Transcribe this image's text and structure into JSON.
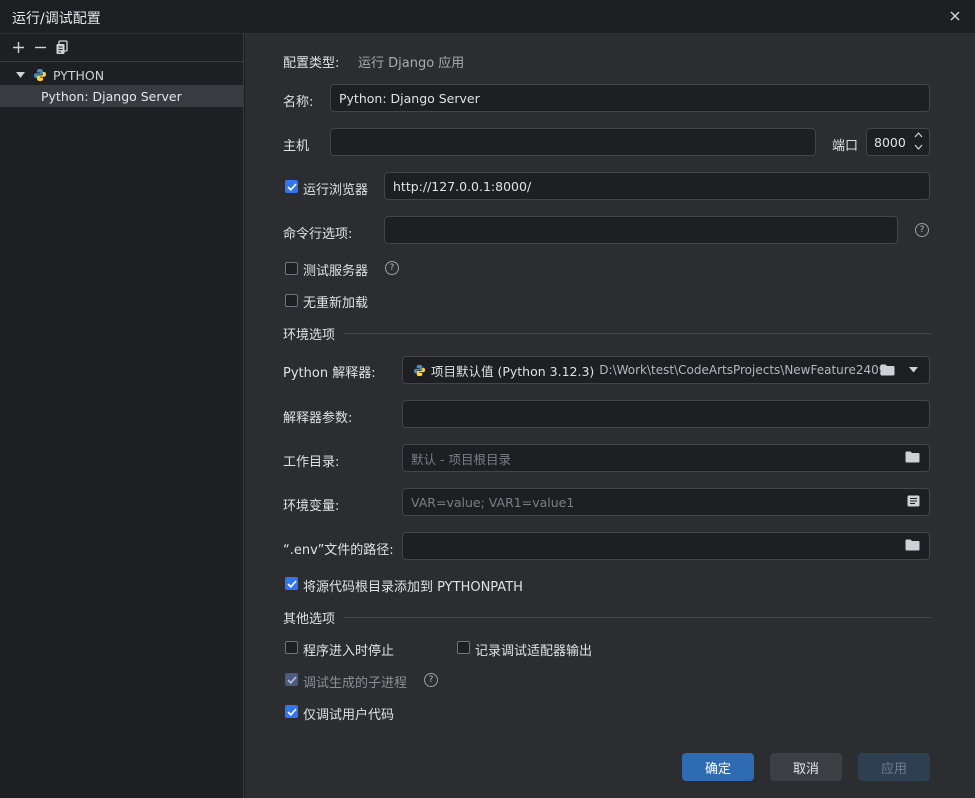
{
  "window": {
    "title": "运行/调试配置"
  },
  "sidebar": {
    "group_label": "PYTHON",
    "item_label": "Python: Django Server"
  },
  "config": {
    "type_label": "配置类型:",
    "type_value": "运行 Django 应用",
    "name_label": "名称:",
    "name_value": "Python: Django Server",
    "host_label": "主机",
    "host_value": "",
    "port_label": "端口",
    "port_value": "8000",
    "run_browser_label": "运行浏览器",
    "run_browser_checked": true,
    "browser_url": "http://127.0.0.1:8000/",
    "cmd_label": "命令行选项:",
    "cmd_value": "",
    "test_server_label": "测试服务器",
    "no_reload_label": "无重新加载"
  },
  "env": {
    "section_label": "环境选项",
    "interpreter_label": "Python 解释器:",
    "interpreter_name": "项目默认值 (Python 3.12.3)",
    "interpreter_path": "D:\\Work\\test\\CodeArtsProjects\\NewFeature2409.",
    "interp_args_label": "解释器参数:",
    "workdir_label": "工作目录:",
    "workdir_placeholder": "默认 - 项目根目录",
    "envvars_label": "环境变量:",
    "envvars_placeholder": "VAR=value; VAR1=value1",
    "dotenv_label": "“.env”文件的路径:",
    "add_pythonpath_label": "将源代码根目录添加到 PYTHONPATH"
  },
  "other": {
    "section_label": "其他选项",
    "stop_on_entry_label": "程序进入时停止",
    "log_adapter_label": "记录调试适配器输出",
    "subprocess_label": "调试生成的子进程",
    "just_my_code_label": "仅调试用户代码"
  },
  "buttons": {
    "ok": "确定",
    "cancel": "取消",
    "apply": "应用"
  },
  "colors": {
    "accent": "#3574f0",
    "primary_button": "#2e6bb0",
    "background": "#2b2d30",
    "sidebar": "#1e1f22"
  }
}
